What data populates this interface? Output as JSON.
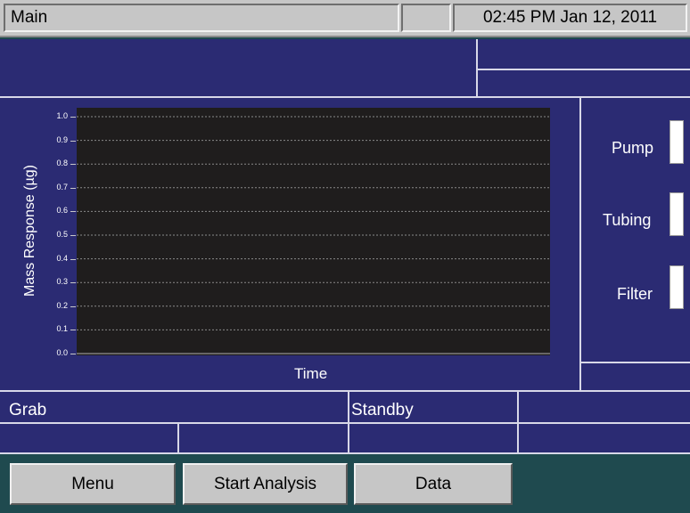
{
  "titlebar": {
    "title": "Main",
    "status": "",
    "datetime": "02:45 PM Jan 12, 2011"
  },
  "chart_data": {
    "type": "line",
    "title": "",
    "xlabel": "Time",
    "ylabel": "Mass Response (µg)",
    "ylim": [
      0,
      1.0
    ],
    "y_ticks": [
      "0.0",
      "0.1",
      "0.2",
      "0.3",
      "0.4",
      "0.5",
      "0.6",
      "0.7",
      "0.8",
      "0.9",
      "1.0"
    ],
    "grid": true,
    "series": []
  },
  "side_status": [
    {
      "label": "Pump"
    },
    {
      "label": "Tubing"
    },
    {
      "label": "Filter"
    }
  ],
  "info": {
    "mode": "Grab",
    "state": "Standby"
  },
  "buttons": {
    "menu": "Menu",
    "start": "Start Analysis",
    "data": "Data"
  },
  "colors": {
    "panel": "#2b2b73",
    "plot_bg": "#1f1d1d",
    "footer": "#1f4a4f",
    "button": "#c6c6c6"
  }
}
